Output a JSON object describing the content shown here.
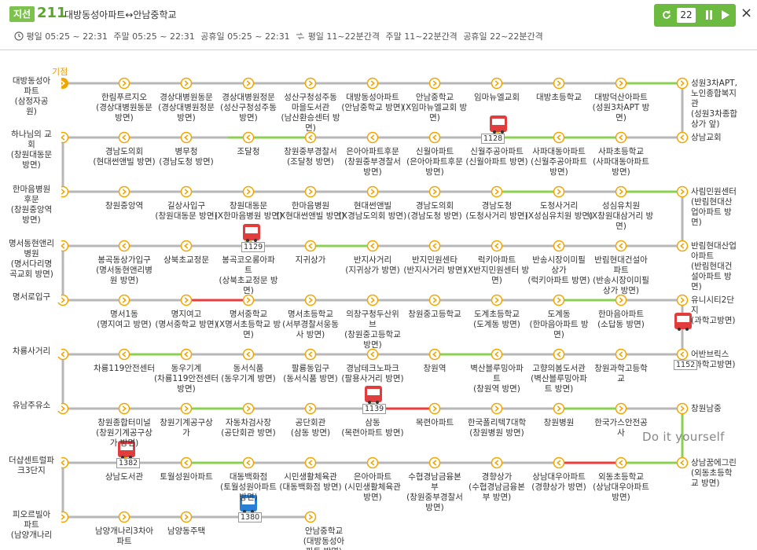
{
  "header": {
    "route_type": "지선",
    "route_number": "211",
    "route_name": "대방동성아파트↔안남중학교",
    "schedule": {
      "weekday": "평일 05:25 ~ 22:31",
      "weekend": "주말 05:25 ~ 22:31",
      "holiday": "공휴일 05:25 ~ 22:31",
      "interval_weekday": "평일 11~22분간격",
      "interval_weekend": "주말 11~22분간격",
      "interval_holiday": "공휴일 22~22분간격"
    },
    "refresh_count": "22",
    "close": "×"
  },
  "start_label": "기점",
  "watermark": "Do it yourself",
  "colors": {
    "accent": "#6dba40",
    "line_gray": "#b7b7b7",
    "green": "#8cd053",
    "red": "#ee3b3b",
    "start": "#f0a500",
    "bus_red": "#e23d3d",
    "bus_blue": "#2a7fd4"
  },
  "rows": [
    {
      "left": "대방동성아\n파트\n(삼정자공\n원)",
      "right": "성원3차APT,\n노인종합복지\n관\n(성원3차종합\n상가 앞)",
      "stops": [
        "한림푸르지오\n(경상대병원동문\n방면)",
        "경상대병원동문\n(경상대병원정문\n방면)",
        "경상대병원정문\n(성산구청성주동\n방면)",
        "성산구청성주동\n마을도서관\n(남산환승센터 방\n면)",
        "대방동성아파트\n(안남중학교 방면)",
        "안남중학교\n(X임마뉴엘교회 방\n면)",
        "임마뉴엘교회",
        "대방초등학교",
        "대방덕산아파트\n(성원3차APT 방\n면)"
      ]
    },
    {
      "left": "하나님의 교\n회\n(창원대동문\n방면)",
      "right": "상남교회",
      "stops": [
        "경남도의회\n(현대썬앤빌 방면)",
        "병무청\n(경남도청 방면)",
        "조달청",
        "창원중부경찰서\n(조달청 방면)",
        "은아아파트후문\n(창원중부경찰서\n방면)",
        "신월아파트\n(은아아파트후문\n방면)",
        "신월주공아파트\n(신월아파트 방면)",
        "사파대동아파트\n(신월주공아파트\n방면)",
        "사파초등학교\n(사파대동아파트\n방면)"
      ]
    },
    {
      "left": "한마음병원\n후문\n(창원중앙역\n방면)",
      "right": "사림민원센터\n(반림현대산\n업아파트 방\n면)",
      "stops": [
        "창원중앙역",
        "길상사입구\n(창원대동문 방면)",
        "창원대동문\n(X한마음병원 방면)",
        "한마음병원\n(X현대썬앤빌 방면)",
        "현대썬앤빌\n(X경남도의회 방면)",
        "경남도의회\n(경남도청 방면)",
        "경남도청\n(도청사거리 방면)",
        "도청사거리\n(X성심유치원 방면)",
        "성심유치원\n(X창원대삼거리 방\n면)"
      ]
    },
    {
      "left": "명서동현앤리\n병원\n(명서다리명\n곡교회 방면)",
      "right": "반림현대산업\n아파트\n(반림현대건\n설아파트 방\n면)",
      "stops": [
        "봉곡동상가입구\n(명서동현앤리병\n원 방면)",
        "상북초교정문",
        "봉곡코오롱아파\n트\n(상북초교정문 방\n면)",
        "지귀상가",
        "반지사거리\n(지귀상가 방면)",
        "반지민원센타\n(반지사거리 방면)",
        "럭키아파트\n(X반지민원센터 방\n면)",
        "반송시장이미필\n상가\n(럭키아파트 방면)",
        "반림현대건설아\n파트\n(반송시장이미필\n상가 방면)"
      ]
    },
    {
      "left": "명서로입구",
      "right": "유니시티2단\n지\n(과학고방면)",
      "stops": [
        "명서1동\n(명지여고 방면)",
        "명지여고\n(명서중학교 방면)",
        "명서중학교\n(X명서초등학교 방\n면)",
        "명서초등학교\n(서부경찰서웅동\n사 방면)",
        "의창구청두산위\n브\n(창원중고등학교\n방면)",
        "창원중고등학교",
        "도계초등학교\n(도계동 방면)",
        "도계동\n(한마음아파트 방\n면)",
        "한마음아파트\n(소답동 방면)"
      ]
    },
    {
      "left": "차룡사거리",
      "right": "어반브릭스\n(과학고방면)",
      "stops": [
        "차룡119안전센터",
        "동우기계\n(차룡119안전센터\n방면)",
        "동서식품\n(동우기계 방면)",
        "팔룡동입구\n(동서식품 방면)",
        "경남테크노파크\n(팔용사거리 방면)",
        "창원역",
        "벽산블루밍아파\n트\n(창원역 방면)",
        "고향의봄도서관\n(벽산블루밍아파\n트 방면)",
        "창원과학고등학\n교"
      ]
    },
    {
      "left": "유남주유소",
      "right": "창원남중",
      "stops": [
        "창원종합터미널\n(창원기계공구상\n가 방면)",
        "창원기계공구상\n가",
        "자동차검사장\n(공단회관 방면)",
        "공단회관\n(삼동 방면)",
        "삼동\n(목련아파트 방면)",
        "목련아파트",
        "한국폴리텍7대학\n(창원병원 방면)",
        "창원병원",
        "한국가스안전공\n사"
      ]
    },
    {
      "left": "더샵센트럴파\n크3단지",
      "right": "상남꿈에그린\n(외동초등학\n교 방면)",
      "stops": [
        "상남도서관",
        "토월성원아파트",
        "대동백화점\n(토월성원아파트\n방면)",
        "시민생활체육관\n(대동백화점 방면)",
        "은아아파트\n(시민생활체육관\n방면)",
        "수협경남금융본\n부\n(창원중부경찰서\n방면)",
        "경향상가\n(수협경남금융본\n부 방면)",
        "상남대우아파트\n(경향상가 방면)",
        "외동초등학교\n(상남대우아파트\n방면)"
      ]
    },
    {
      "left": "피오르빌아\n파트\n(남양개나리",
      "right": "",
      "stops": [
        "남양개나리3차아\n파트",
        "남양동주택",
        "",
        "안남중학교\n(대방동성아\n파트 방면)"
      ]
    }
  ],
  "buses": [
    {
      "plate": "1128"
    },
    {
      "plate": "1129"
    },
    {
      "plate": "1152"
    },
    {
      "plate": "1139"
    },
    {
      "plate": "1382"
    },
    {
      "plate": "1380"
    }
  ]
}
